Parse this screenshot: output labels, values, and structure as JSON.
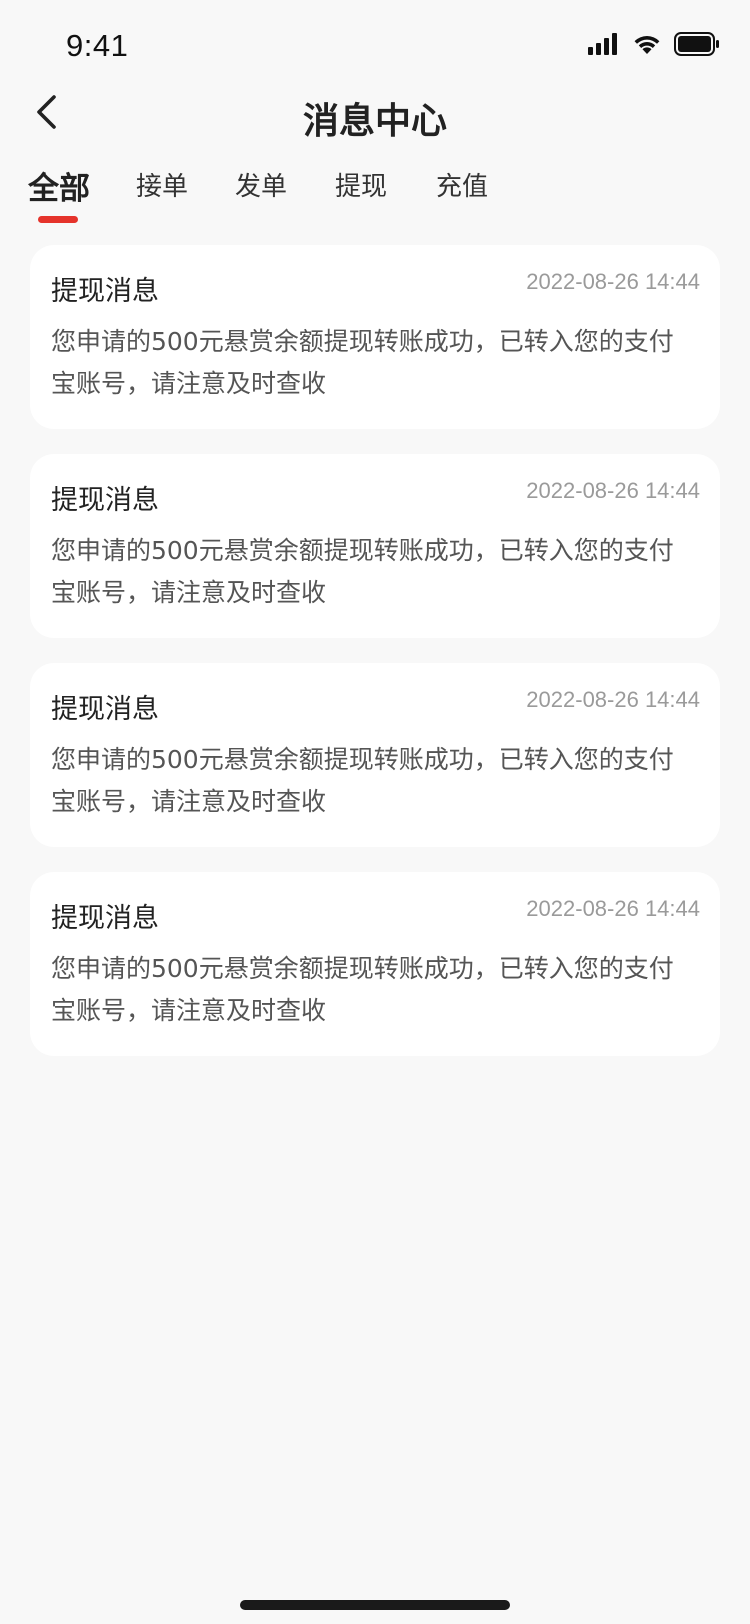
{
  "status_bar": {
    "time": "9:41",
    "icons": [
      "signal-icon",
      "wifi-icon",
      "battery-icon"
    ]
  },
  "nav": {
    "title": "消息中心",
    "back_icon": "chevron-left-icon"
  },
  "tabs": [
    {
      "label": "全部",
      "active": true
    },
    {
      "label": "接单",
      "active": false
    },
    {
      "label": "发单",
      "active": false
    },
    {
      "label": "提现",
      "active": false
    },
    {
      "label": "充值",
      "active": false
    }
  ],
  "colors": {
    "accent": "#e5332b",
    "background": "#f8f8f8",
    "card": "#ffffff",
    "muted_text": "#9a9a9a"
  },
  "messages": [
    {
      "title": "提现消息",
      "time": "2022-08-26 14:44",
      "body": "您申请的500元悬赏余额提现转账成功，已转入您的支付宝账号，请注意及时查收"
    },
    {
      "title": "提现消息",
      "time": "2022-08-26 14:44",
      "body": "您申请的500元悬赏余额提现转账成功，已转入您的支付宝账号，请注意及时查收"
    },
    {
      "title": "提现消息",
      "time": "2022-08-26 14:44",
      "body": "您申请的500元悬赏余额提现转账成功，已转入您的支付宝账号，请注意及时查收"
    },
    {
      "title": "提现消息",
      "time": "2022-08-26 14:44",
      "body": "您申请的500元悬赏余额提现转账成功，已转入您的支付宝账号，请注意及时查收"
    }
  ]
}
